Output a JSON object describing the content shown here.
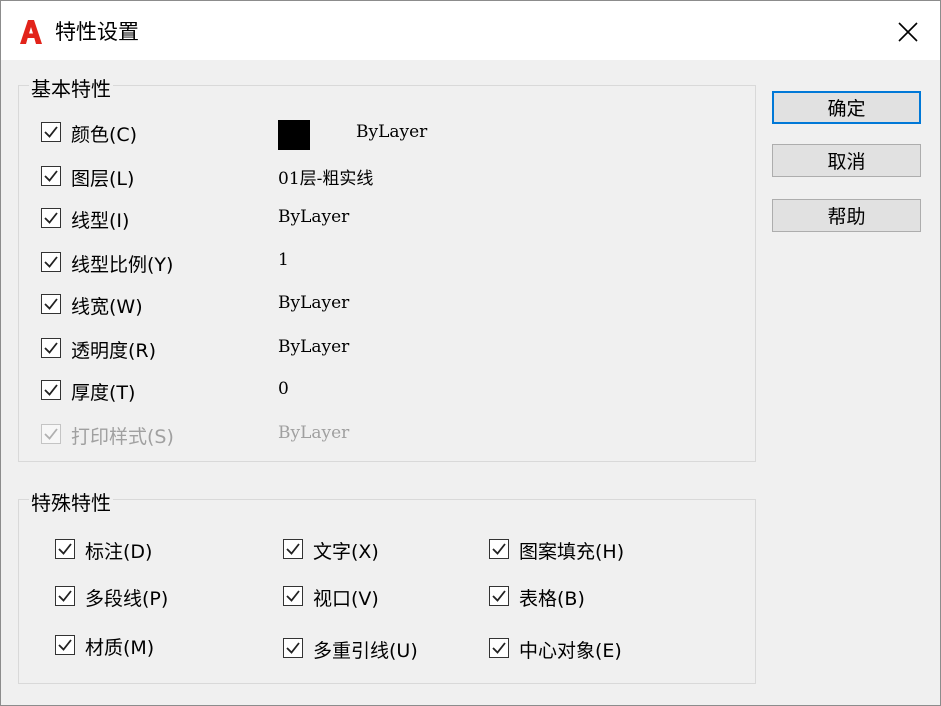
{
  "window": {
    "title": "特性设置",
    "app_icon": "autocad-a-icon",
    "close_icon": "close-x-icon"
  },
  "basic": {
    "title": "基本特性",
    "rows": [
      {
        "label": "颜色(C)",
        "value": "ByLayer",
        "checked": true,
        "enabled": true,
        "swatch": "#000000"
      },
      {
        "label": "图层(L)",
        "value": "01层-粗实线",
        "checked": true,
        "enabled": true
      },
      {
        "label": "线型(I)",
        "value": "ByLayer",
        "checked": true,
        "enabled": true
      },
      {
        "label": "线型比例(Y)",
        "value": "1",
        "checked": true,
        "enabled": true
      },
      {
        "label": "线宽(W)",
        "value": "ByLayer",
        "checked": true,
        "enabled": true
      },
      {
        "label": "透明度(R)",
        "value": "ByLayer",
        "checked": true,
        "enabled": true
      },
      {
        "label": "厚度(T)",
        "value": "0",
        "checked": true,
        "enabled": true
      },
      {
        "label": "打印样式(S)",
        "value": "ByLayer",
        "checked": true,
        "enabled": false
      }
    ]
  },
  "special": {
    "title": "特殊特性",
    "items": [
      {
        "label": "标注(D)",
        "checked": true
      },
      {
        "label": "文字(X)",
        "checked": true
      },
      {
        "label": "图案填充(H)",
        "checked": true
      },
      {
        "label": "多段线(P)",
        "checked": true
      },
      {
        "label": "视口(V)",
        "checked": true
      },
      {
        "label": "表格(B)",
        "checked": true
      },
      {
        "label": "材质(M)",
        "checked": true
      },
      {
        "label": "多重引线(U)",
        "checked": true
      },
      {
        "label": "中心对象(E)",
        "checked": true
      }
    ]
  },
  "buttons": {
    "ok": "确定",
    "cancel": "取消",
    "help": "帮助"
  }
}
